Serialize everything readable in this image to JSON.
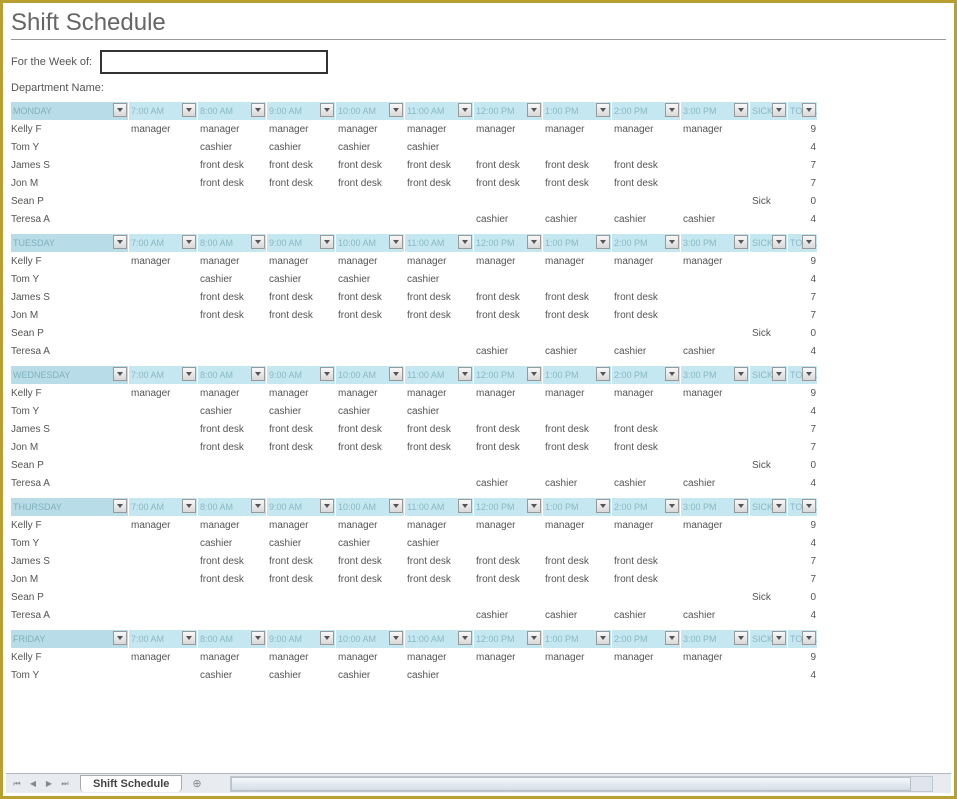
{
  "title": "Shift Schedule",
  "meta": {
    "week_label": "For the Week of:",
    "week_value": "",
    "dept_label": "Department Name:"
  },
  "time_headers": [
    "7:00 AM",
    "8:00 AM",
    "9:00 AM",
    "10:00 AM",
    "11:00 AM",
    "12:00 PM",
    "1:00 PM",
    "2:00 PM",
    "3:00 PM"
  ],
  "sick_header": "SICK?",
  "total_header": "TOTAL",
  "days": [
    {
      "name": "MONDAY",
      "rows": [
        {
          "name": "Kelly F",
          "cells": [
            "manager",
            "manager",
            "manager",
            "manager",
            "manager",
            "manager",
            "manager",
            "manager",
            "manager"
          ],
          "sick": "",
          "total": "9"
        },
        {
          "name": "Tom Y",
          "cells": [
            "",
            "cashier",
            "cashier",
            "cashier",
            "cashier",
            "",
            "",
            "",
            ""
          ],
          "sick": "",
          "total": "4"
        },
        {
          "name": "James S",
          "cells": [
            "",
            "front desk",
            "front desk",
            "front desk",
            "front desk",
            "front desk",
            "front desk",
            "front desk",
            ""
          ],
          "sick": "",
          "total": "7"
        },
        {
          "name": "Jon M",
          "cells": [
            "",
            "front desk",
            "front desk",
            "front desk",
            "front desk",
            "front desk",
            "front desk",
            "front desk",
            ""
          ],
          "sick": "",
          "total": "7"
        },
        {
          "name": "Sean P",
          "cells": [
            "",
            "",
            "",
            "",
            "",
            "",
            "",
            "",
            ""
          ],
          "sick": "Sick",
          "total": "0"
        },
        {
          "name": "Teresa A",
          "cells": [
            "",
            "",
            "",
            "",
            "",
            "cashier",
            "cashier",
            "cashier",
            "cashier"
          ],
          "sick": "",
          "total": "4"
        }
      ]
    },
    {
      "name": "TUESDAY",
      "rows": [
        {
          "name": "Kelly F",
          "cells": [
            "manager",
            "manager",
            "manager",
            "manager",
            "manager",
            "manager",
            "manager",
            "manager",
            "manager"
          ],
          "sick": "",
          "total": "9"
        },
        {
          "name": "Tom Y",
          "cells": [
            "",
            "cashier",
            "cashier",
            "cashier",
            "cashier",
            "",
            "",
            "",
            ""
          ],
          "sick": "",
          "total": "4"
        },
        {
          "name": "James S",
          "cells": [
            "",
            "front desk",
            "front desk",
            "front desk",
            "front desk",
            "front desk",
            "front desk",
            "front desk",
            ""
          ],
          "sick": "",
          "total": "7"
        },
        {
          "name": "Jon M",
          "cells": [
            "",
            "front desk",
            "front desk",
            "front desk",
            "front desk",
            "front desk",
            "front desk",
            "front desk",
            ""
          ],
          "sick": "",
          "total": "7"
        },
        {
          "name": "Sean P",
          "cells": [
            "",
            "",
            "",
            "",
            "",
            "",
            "",
            "",
            ""
          ],
          "sick": "Sick",
          "total": "0"
        },
        {
          "name": "Teresa A",
          "cells": [
            "",
            "",
            "",
            "",
            "",
            "cashier",
            "cashier",
            "cashier",
            "cashier"
          ],
          "sick": "",
          "total": "4"
        }
      ]
    },
    {
      "name": "WEDNESDAY",
      "rows": [
        {
          "name": "Kelly F",
          "cells": [
            "manager",
            "manager",
            "manager",
            "manager",
            "manager",
            "manager",
            "manager",
            "manager",
            "manager"
          ],
          "sick": "",
          "total": "9"
        },
        {
          "name": "Tom Y",
          "cells": [
            "",
            "cashier",
            "cashier",
            "cashier",
            "cashier",
            "",
            "",
            "",
            ""
          ],
          "sick": "",
          "total": "4"
        },
        {
          "name": "James S",
          "cells": [
            "",
            "front desk",
            "front desk",
            "front desk",
            "front desk",
            "front desk",
            "front desk",
            "front desk",
            ""
          ],
          "sick": "",
          "total": "7"
        },
        {
          "name": "Jon M",
          "cells": [
            "",
            "front desk",
            "front desk",
            "front desk",
            "front desk",
            "front desk",
            "front desk",
            "front desk",
            ""
          ],
          "sick": "",
          "total": "7"
        },
        {
          "name": "Sean P",
          "cells": [
            "",
            "",
            "",
            "",
            "",
            "",
            "",
            "",
            ""
          ],
          "sick": "Sick",
          "total": "0"
        },
        {
          "name": "Teresa A",
          "cells": [
            "",
            "",
            "",
            "",
            "",
            "cashier",
            "cashier",
            "cashier",
            "cashier"
          ],
          "sick": "",
          "total": "4"
        }
      ]
    },
    {
      "name": "THURSDAY",
      "rows": [
        {
          "name": "Kelly F",
          "cells": [
            "manager",
            "manager",
            "manager",
            "manager",
            "manager",
            "manager",
            "manager",
            "manager",
            "manager"
          ],
          "sick": "",
          "total": "9"
        },
        {
          "name": "Tom Y",
          "cells": [
            "",
            "cashier",
            "cashier",
            "cashier",
            "cashier",
            "",
            "",
            "",
            ""
          ],
          "sick": "",
          "total": "4"
        },
        {
          "name": "James S",
          "cells": [
            "",
            "front desk",
            "front desk",
            "front desk",
            "front desk",
            "front desk",
            "front desk",
            "front desk",
            ""
          ],
          "sick": "",
          "total": "7"
        },
        {
          "name": "Jon M",
          "cells": [
            "",
            "front desk",
            "front desk",
            "front desk",
            "front desk",
            "front desk",
            "front desk",
            "front desk",
            ""
          ],
          "sick": "",
          "total": "7"
        },
        {
          "name": "Sean P",
          "cells": [
            "",
            "",
            "",
            "",
            "",
            "",
            "",
            "",
            ""
          ],
          "sick": "Sick",
          "total": "0"
        },
        {
          "name": "Teresa A",
          "cells": [
            "",
            "",
            "",
            "",
            "",
            "cashier",
            "cashier",
            "cashier",
            "cashier"
          ],
          "sick": "",
          "total": "4"
        }
      ]
    },
    {
      "name": "FRIDAY",
      "rows": [
        {
          "name": "Kelly F",
          "cells": [
            "manager",
            "manager",
            "manager",
            "manager",
            "manager",
            "manager",
            "manager",
            "manager",
            "manager"
          ],
          "sick": "",
          "total": "9"
        },
        {
          "name": "Tom Y",
          "cells": [
            "",
            "cashier",
            "cashier",
            "cashier",
            "cashier",
            "",
            "",
            "",
            ""
          ],
          "sick": "",
          "total": "4"
        }
      ]
    }
  ],
  "sheet_tab": "Shift Schedule",
  "next_tab": "⊕"
}
